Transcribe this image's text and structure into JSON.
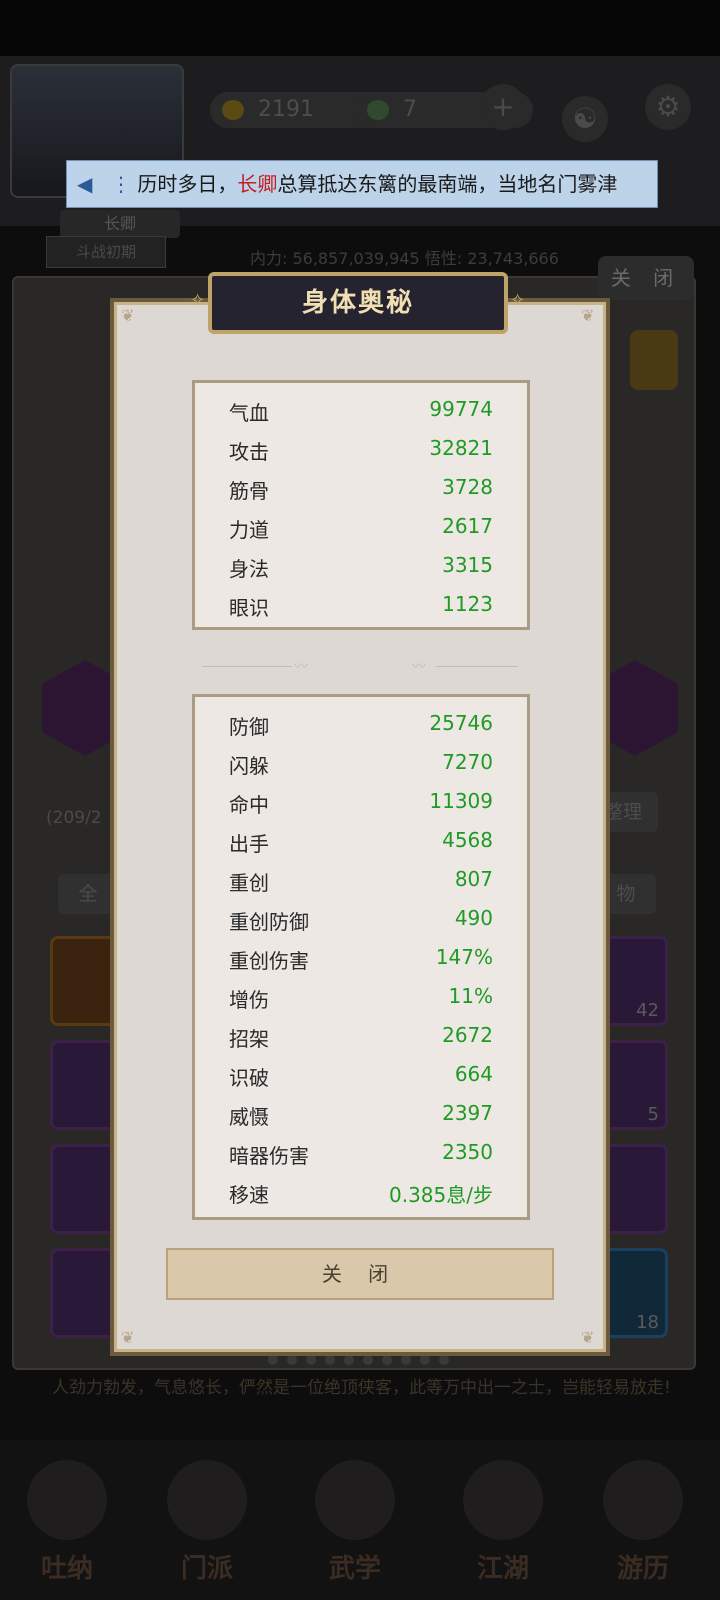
{
  "background": {
    "resources": [
      {
        "icon": "gold-coin-icon",
        "value": "2191"
      },
      {
        "icon": "jade-ticket-icon",
        "value": "7"
      }
    ],
    "character_name": "长卿",
    "rank_button": "斗战初期",
    "power_text": "内力: 56,857,039,945  悟性: 23,743,666",
    "close_label": "关 闭",
    "inventory_count": "(209/2",
    "sort_button": "整理",
    "filter_all": "全",
    "filter_items": "物",
    "slot_counts": [
      "42",
      "5",
      "18"
    ],
    "description": "人劲力勃发，气息悠长，俨然是一位绝顶侠客，此等万中出一之士，岂能轻易放走!",
    "nav": [
      {
        "label": "吐纳",
        "icon": "meditation-icon"
      },
      {
        "label": "门派",
        "icon": "sect-icon"
      },
      {
        "label": "武学",
        "icon": "martial-arts-icon"
      },
      {
        "label": "江湖",
        "icon": "jianghu-icon"
      },
      {
        "label": "游历",
        "icon": "travel-icon"
      }
    ]
  },
  "notice": {
    "icon": "megaphone-icon",
    "prefix": "历时多日，",
    "highlight": "长卿",
    "suffix": "总算抵达东篱的最南端，当地名门雾津"
  },
  "modal": {
    "title": "身体奥秘",
    "base_stats": [
      {
        "label": "气血",
        "value": "99774"
      },
      {
        "label": "攻击",
        "value": "32821"
      },
      {
        "label": "筋骨",
        "value": "3728"
      },
      {
        "label": "力道",
        "value": "2617"
      },
      {
        "label": "身法",
        "value": "3315"
      },
      {
        "label": "眼识",
        "value": "1123"
      }
    ],
    "combat_stats": [
      {
        "label": "防御",
        "value": "25746"
      },
      {
        "label": "闪躲",
        "value": "7270"
      },
      {
        "label": "命中",
        "value": "11309"
      },
      {
        "label": "出手",
        "value": "4568"
      },
      {
        "label": "重创",
        "value": "807"
      },
      {
        "label": "重创防御",
        "value": "490"
      },
      {
        "label": "重创伤害",
        "value": "147%"
      },
      {
        "label": "增伤",
        "value": "11%"
      },
      {
        "label": "招架",
        "value": "2672"
      },
      {
        "label": "识破",
        "value": "664"
      },
      {
        "label": "威慑",
        "value": "2397"
      },
      {
        "label": "暗器伤害",
        "value": "2350"
      },
      {
        "label": "移速",
        "value": "0.385息/步"
      }
    ],
    "close_button": "关 闭"
  },
  "colors": {
    "stat_value": "#1f9a25",
    "notice_highlight": "#c42020",
    "modal_bg": "#ddd8d3",
    "title_bg": "#262330"
  }
}
